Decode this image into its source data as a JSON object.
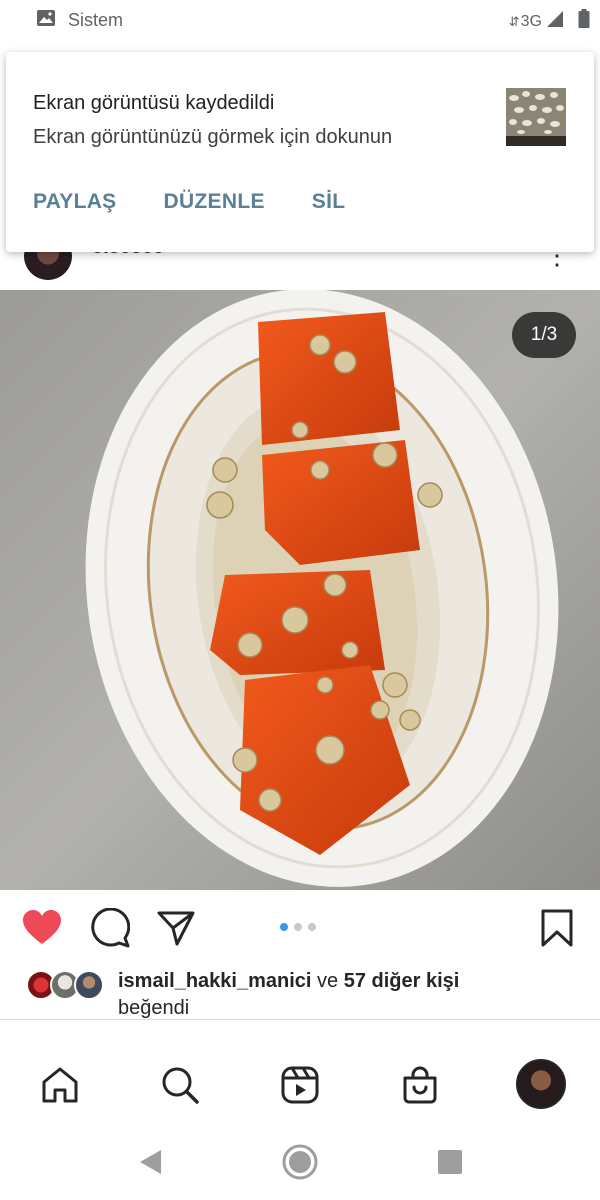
{
  "status_bar": {
    "app_label": "Sistem",
    "network": "3G",
    "icons": [
      "image-icon",
      "network-arrows-icon",
      "signal-icon",
      "battery-icon"
    ]
  },
  "notification": {
    "title": "Ekran görüntüsü kaydedildi",
    "body": "Ekran görüntünüzü görmek için dokunun",
    "actions": [
      "PAYLAŞ",
      "DÜZENLE",
      "SİL"
    ],
    "action_color": "#5a7f96"
  },
  "post": {
    "username": "5.30300",
    "more_icon": "more-vertical-icon",
    "page_counter": "1/3",
    "carousel": {
      "current": 1,
      "total": 3
    },
    "liked": true,
    "like_color": "#ed4956"
  },
  "likes": {
    "first_user": "ismail_hakki_manici",
    "connector": "ve",
    "others": "57 diğer kişi",
    "suffix": "beğendi"
  },
  "bottom_nav": [
    "home-icon",
    "search-icon",
    "reels-icon",
    "shop-icon",
    "profile-avatar"
  ],
  "system_nav": [
    "back-icon",
    "home-circle-icon",
    "recents-icon"
  ],
  "colors": {
    "accent_blue": "#3897f0",
    "text": "#262626"
  }
}
